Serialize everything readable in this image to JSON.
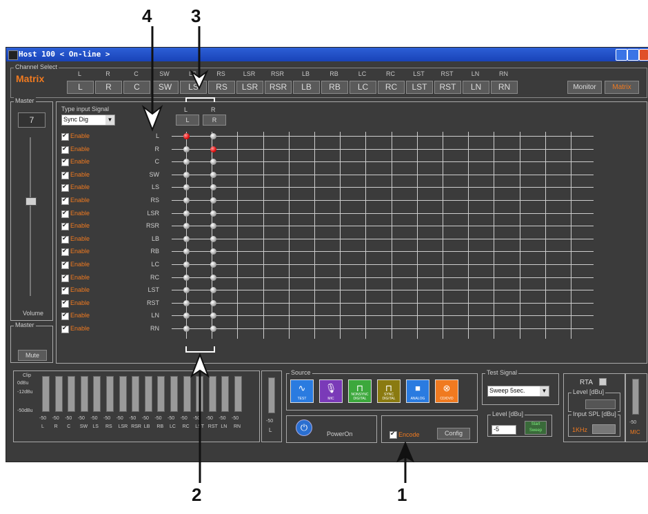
{
  "window": {
    "title": "Host 100  < On-line >"
  },
  "channel_select": {
    "title": "Channel Select",
    "mode_label": "Matrix",
    "channels": [
      "L",
      "R",
      "C",
      "SW",
      "LS",
      "RS",
      "LSR",
      "RSR",
      "LB",
      "RB",
      "LC",
      "RC",
      "LST",
      "RST",
      "LN",
      "RN"
    ],
    "monitor_label": "Monitor",
    "matrix_label": "Matrix"
  },
  "master": {
    "title": "Master",
    "volume_value": "7",
    "volume_label": "Volume",
    "mute_title": "Master",
    "mute_label": "Mute",
    "volume_level": 0.62
  },
  "matrix": {
    "type_input_label": "Type input Signal",
    "type_input_value": "Sync Dig",
    "out_headers": [
      "L",
      "R"
    ],
    "out_buttons": [
      "L",
      "R"
    ],
    "enable_label": "Enable",
    "rows": [
      "L",
      "R",
      "C",
      "SW",
      "LS",
      "RS",
      "LSR",
      "RSR",
      "LB",
      "RB",
      "LC",
      "RC",
      "LST",
      "RST",
      "LN",
      "RN"
    ],
    "active_routes": [
      [
        0,
        0
      ],
      [
        1,
        1
      ]
    ]
  },
  "meters": {
    "top_labels": [
      "Clip",
      "0dBu",
      "-12dBu",
      "-50dBu"
    ],
    "bottom_value": "-50",
    "channels": [
      "L",
      "R",
      "C",
      "SW",
      "LS",
      "RS",
      "LSR",
      "RSR",
      "LB",
      "RB",
      "LC",
      "RC",
      "LST",
      "RST",
      "LN",
      "RN"
    ],
    "master_value": "-50",
    "master_label": "L"
  },
  "source": {
    "title": "Source",
    "buttons": [
      {
        "label": "TEST",
        "color": "#2a7be0",
        "icon": "waveform-icon"
      },
      {
        "label": "MIC",
        "color": "#7a3ab8",
        "icon": "microphone-icon"
      },
      {
        "label": "NONSYNC DIGITAL",
        "color": "#3ca83c",
        "icon": "square-wave-icon"
      },
      {
        "label": "SYNC DIGITAL",
        "color": "#8a7a10",
        "icon": "square-wave-icon"
      },
      {
        "label": "ANALOG",
        "color": "#2a7be0",
        "icon": "camera-icon"
      },
      {
        "label": "CD/DVD",
        "color": "#f07a20",
        "icon": "disc-icon"
      }
    ],
    "power_label": "PowerOn",
    "encode_label": "Encode",
    "config_label": "Config"
  },
  "test_signal": {
    "title": "Test Signal",
    "value": "Sweep 5sec.",
    "level_title": "Level [dBu]",
    "level_value": "-5",
    "start_label": "Start Sweep"
  },
  "rta": {
    "label": "RTA",
    "level_title": "Level [dBu]",
    "spl_title": "Input SPL [dBu]",
    "freq_label": "1KHz",
    "mic_value": "-50",
    "mic_label": "MIC"
  },
  "annotations": [
    "4",
    "3",
    "2",
    "1"
  ]
}
